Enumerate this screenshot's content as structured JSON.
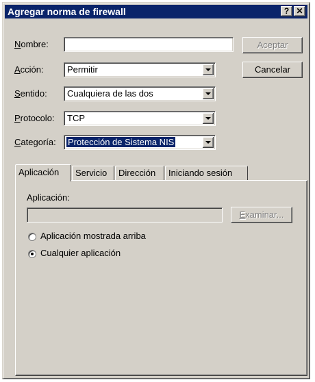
{
  "window": {
    "title": "Agregar norma de firewall",
    "help_label": "?",
    "close_label": "✕"
  },
  "form": {
    "nombre_label": "Nombre:",
    "nombre_value": "",
    "accion_label": "Acción:",
    "accion_value": "Permitir",
    "sentido_label": "Sentido:",
    "sentido_value": "Cualquiera de las dos",
    "protocolo_label": "Protocolo:",
    "protocolo_value": "TCP",
    "categoria_label": "Categoría:",
    "categoria_value": "Protección de Sistema NIS"
  },
  "buttons": {
    "accept": "Aceptar",
    "cancel": "Cancelar",
    "browse": "Examinar..."
  },
  "tabs": [
    {
      "label": "Aplicación"
    },
    {
      "label": "Servicio"
    },
    {
      "label": "Dirección"
    },
    {
      "label": "Iniciando sesión"
    }
  ],
  "application_panel": {
    "app_label": "Aplicación:",
    "app_value": "",
    "radio_shown": "Aplicación mostrada arriba",
    "radio_any": "Cualquier aplicación",
    "selected": "radio_any"
  },
  "colors": {
    "titlebar": "#0a246a",
    "face": "#d4d0c8",
    "selection": "#0a246a"
  }
}
